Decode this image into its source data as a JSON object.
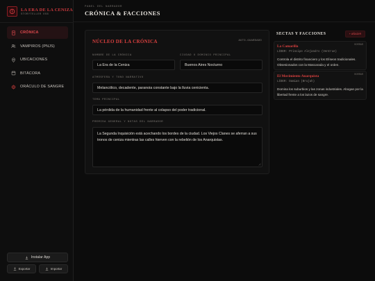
{
  "brand": {
    "title": "LA ERA DE LA CENIZA",
    "subtitle": "STORYTELLER OS6"
  },
  "nav": {
    "items": [
      {
        "label": "CRÓNICA",
        "icon": "book-icon",
        "active": true
      },
      {
        "label": "VAMPIROS (PNJS)",
        "icon": "users-icon",
        "active": false
      },
      {
        "label": "UBICACIONES",
        "icon": "map-pin-icon",
        "active": false
      },
      {
        "label": "BITÁCORA",
        "icon": "notebook-icon",
        "active": false
      },
      {
        "label": "ORÁCULO DE SANGRE",
        "icon": "oracle-icon",
        "active": false
      }
    ]
  },
  "footer": {
    "install_label": "Instalar App",
    "export_label": "Exportar",
    "import_label": "Importar"
  },
  "header": {
    "kicker": "PANEL DEL NARRADOR",
    "title": "CRÓNICA & FACCIONES"
  },
  "core": {
    "title": "NÚCLEO DE LA CRÓNICA",
    "autosave": "AUTO-GUARDADO",
    "fields": {
      "name_label": "NOMBRE DE LA CRÓNICA",
      "name_value": "La Era de la Ceniza",
      "city_label": "CIUDAD O DOMINIO PRINCIPAL",
      "city_value": "Buenos Aires Nocturno",
      "mood_label": "ATMÓSFERA Y TONO NARRATIVO",
      "mood_value": "Melancólico, decadente, paranoia constante bajo la lluvia cenicienta.",
      "theme_label": "TEMA PRINCIPAL",
      "theme_value": "La pérdida de la humanidad frente al colapso del poder tradicional.",
      "premise_label": "PREMISA GENERAL Y NOTAS DEL NARRADOR",
      "premise_value": "La Segunda Inquisición está acechando los bordes de la ciudad. Los Viejos Clanes se aferran a sus tronos de ceniza mientras las calles hierven con la rebelión de los Anarquistas."
    }
  },
  "sects": {
    "title": "SECTAS Y FACCIONES",
    "add_label": "+ AÑADIR",
    "items": [
      {
        "name": "La Camarilla",
        "delete_label": "BORRAR",
        "leader": "LÍDER: Príncipe Alejandro (Ventrue)",
        "description": "Controla el distrito financiero y los Elíseos tradicionales. Obsesionados con la Mascarada y el orden."
      },
      {
        "name": "El Movimiento Anarquista",
        "delete_label": "BORRAR",
        "leader": "LÍDER: Damian (Brujah)",
        "description": "Domina los suburbios y las zonas industriales. Abogan por la libertad frente a los lazos de sangre."
      }
    ]
  },
  "colors": {
    "accent": "#d9403f",
    "background": "#0c0c0c",
    "panel": "#111111"
  }
}
